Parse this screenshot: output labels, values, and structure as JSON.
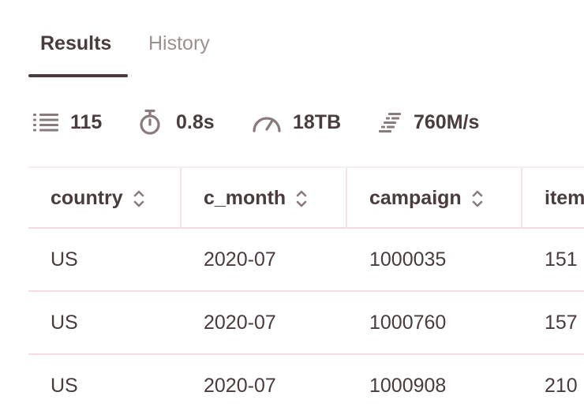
{
  "tabs": [
    {
      "label": "Results",
      "active": true
    },
    {
      "label": "History",
      "active": false
    }
  ],
  "stats": {
    "rows": "115",
    "time": "0.8s",
    "data": "18TB",
    "speed": "760M/s"
  },
  "table": {
    "columns": [
      "country",
      "c_month",
      "campaign",
      "item"
    ],
    "rows": [
      [
        "US",
        "2020-07",
        "1000035",
        "151"
      ],
      [
        "US",
        "2020-07",
        "1000760",
        "157"
      ],
      [
        "US",
        "2020-07",
        "1000908",
        "210"
      ]
    ]
  },
  "colors": {
    "text": "#4a3b3c",
    "muted": "#9e8e8f",
    "divider": "#f7dde2"
  }
}
